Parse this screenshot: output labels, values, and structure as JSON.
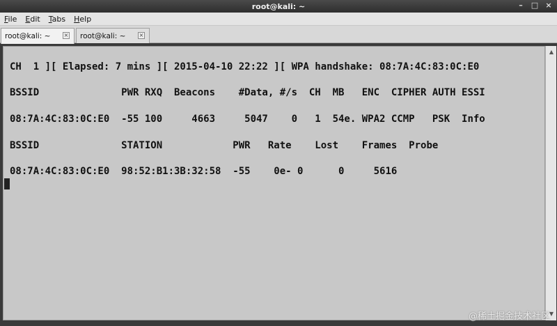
{
  "window": {
    "title": "root@kali: ~"
  },
  "menu": {
    "items": [
      {
        "accel": "F",
        "rest": "ile"
      },
      {
        "accel": "E",
        "rest": "dit"
      },
      {
        "accel": "T",
        "rest": "abs"
      },
      {
        "accel": "H",
        "rest": "elp"
      }
    ]
  },
  "tabs": [
    {
      "label": "root@kali: ~"
    },
    {
      "label": "root@kali: ~"
    }
  ],
  "terminal": {
    "lines": [
      "CH  1 ][ Elapsed: 7 mins ][ 2015-04-10 22:22 ][ WPA handshake: 08:7A:4C:83:0C:E0",
      "BSSID              PWR RXQ  Beacons    #Data, #/s  CH  MB   ENC  CIPHER AUTH ESSI",
      "08:7A:4C:83:0C:E0  -55 100     4663     5047    0   1  54e. WPA2 CCMP   PSK  Info",
      "BSSID              STATION            PWR   Rate    Lost    Frames  Probe",
      "08:7A:4C:83:0C:E0  98:52:B1:3B:32:58  -55    0e- 0      0     5616"
    ]
  },
  "watermark": "@稀土掘金技术社区"
}
